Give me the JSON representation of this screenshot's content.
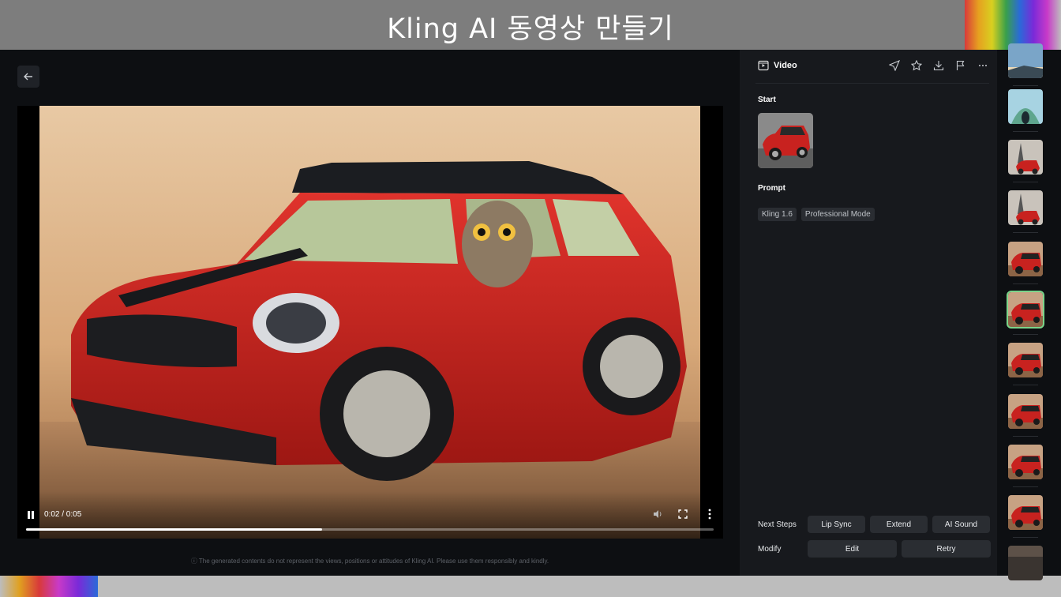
{
  "banner": {
    "title": "Kling AI 동영상 만들기"
  },
  "panel": {
    "title": "Video",
    "start_label": "Start",
    "prompt_label": "Prompt",
    "tags": [
      "Kling 1.6",
      "Professional Mode"
    ],
    "next_steps_label": "Next Steps",
    "next_steps": [
      "Lip Sync",
      "Extend",
      "AI Sound"
    ],
    "modify_label": "Modify",
    "modify": [
      "Edit",
      "Retry"
    ],
    "actions": [
      "send-icon",
      "star-icon",
      "download-icon",
      "flag-icon",
      "more-horizontal-icon"
    ]
  },
  "player": {
    "time": "0:02 / 0:05",
    "progress": 0.43
  },
  "disclaimer": "ⓘ The generated contents do not represent the views, positions or attitudes of Kling AI. Please use them responsibly and kindly.",
  "thumbnails": {
    "count": 11,
    "active_index": 5
  },
  "colors": {
    "car_red": "#c8221f",
    "active_outline": "#7ad58a",
    "panel_bg": "#17191d",
    "app_bg": "#0d0f12"
  }
}
